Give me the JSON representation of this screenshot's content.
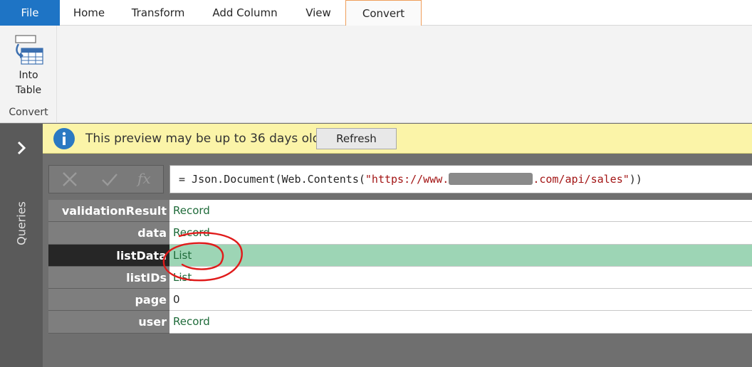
{
  "tabs": [
    {
      "label": "File"
    },
    {
      "label": "Home"
    },
    {
      "label": "Transform"
    },
    {
      "label": "Add Column"
    },
    {
      "label": "View"
    },
    {
      "label": "Convert"
    }
  ],
  "active_tab": "Convert",
  "ribbon": {
    "into_table_line1": "Into",
    "into_table_line2": "Table",
    "group_label": "Convert"
  },
  "queries_pane": {
    "label": "Queries",
    "chevron_icon": "chevron-right-icon"
  },
  "infobar": {
    "icon": "info-icon",
    "message": "This preview may be up to 36 days old.",
    "refresh_label": "Refresh"
  },
  "formula_bar": {
    "prefix": "= Json.Document(Web.Contents(",
    "string_start": "\"https://www.",
    "string_end": ".com/api/sales\"",
    "suffix": "))",
    "cancel_icon": "close-icon",
    "commit_icon": "check-icon",
    "fx_label": "fx"
  },
  "record": [
    {
      "key": "validationResult",
      "value": "Record"
    },
    {
      "key": "data",
      "value": "Record"
    },
    {
      "key": "listData",
      "value": "List"
    },
    {
      "key": "listIDs",
      "value": "List"
    },
    {
      "key": "page",
      "value": "0"
    },
    {
      "key": "user",
      "value": "Record"
    }
  ],
  "selected_row": "listData",
  "colors": {
    "file_tab": "#1e74c5",
    "active_tab_border": "#ef9e5a",
    "infobar_bg": "#fbf4a8",
    "selected_row": "#9dd5b5",
    "annotation": "#e01b1b"
  }
}
